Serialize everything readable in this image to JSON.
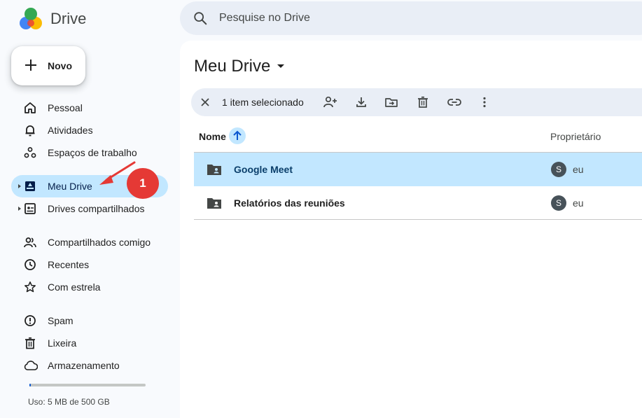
{
  "app": {
    "name": "Drive"
  },
  "search": {
    "placeholder": "Pesquise no Drive"
  },
  "new_button": {
    "label": "Novo"
  },
  "sidebar": {
    "items": [
      {
        "label": "Pessoal",
        "icon": "home-icon"
      },
      {
        "label": "Atividades",
        "icon": "bell-icon"
      },
      {
        "label": "Espaços de trabalho",
        "icon": "workspaces-icon"
      },
      {
        "label": "Meu Drive",
        "icon": "my-drive-icon",
        "active": true
      },
      {
        "label": "Drives compartilhados",
        "icon": "shared-drives-icon"
      },
      {
        "label": "Compartilhados comigo",
        "icon": "people-icon"
      },
      {
        "label": "Recentes",
        "icon": "clock-icon"
      },
      {
        "label": "Com estrela",
        "icon": "star-icon"
      },
      {
        "label": "Spam",
        "icon": "spam-icon"
      },
      {
        "label": "Lixeira",
        "icon": "trash-icon"
      },
      {
        "label": "Armazenamento",
        "icon": "cloud-icon"
      }
    ],
    "storage": {
      "text": "Uso: 5 MB de 500 GB",
      "fraction": 0.01
    }
  },
  "main": {
    "title": "Meu Drive",
    "selection": {
      "count_label": "1 item selecionado"
    },
    "columns": {
      "name": "Nome",
      "owner": "Proprietário"
    },
    "rows": [
      {
        "name": "Google Meet",
        "owner_initial": "S",
        "owner": "eu",
        "selected": true
      },
      {
        "name": "Relatórios das reuniões",
        "owner_initial": "S",
        "owner": "eu",
        "selected": false
      }
    ]
  },
  "annotation": {
    "step": "1"
  },
  "colors": {
    "accent": "#0b57d0",
    "selected_bg": "#c2e7ff",
    "annotation": "#e53935"
  }
}
